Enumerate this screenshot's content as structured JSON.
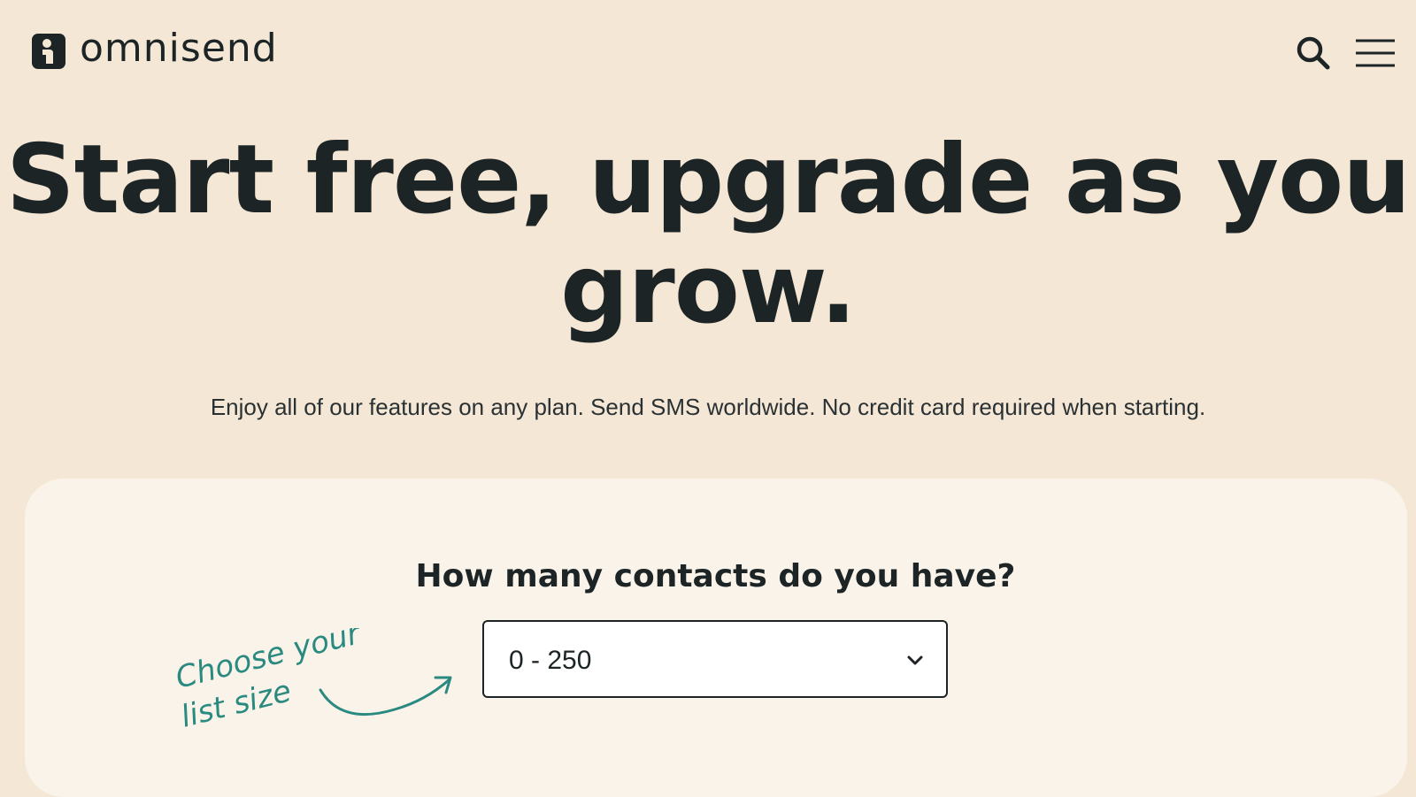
{
  "header": {
    "logo_text": "omnisend",
    "logo_icon": "omnisend-logo-icon",
    "search_icon": "search-icon",
    "menu_icon": "hamburger-menu-icon"
  },
  "hero": {
    "title": "Start free, upgrade as you grow.",
    "subtitle": "Enjoy all of our features on any plan. Send SMS worldwide. No credit card required when starting."
  },
  "pricing_card": {
    "question": "How many contacts do you have?",
    "contacts_select": {
      "value": "0 - 250",
      "icon": "chevron-down-icon"
    },
    "annotation": {
      "line1": "Choose your",
      "line2": "list size",
      "icon": "curved-arrow-icon"
    }
  },
  "colors": {
    "background": "#f4e7d6",
    "card": "#faf3ea",
    "text": "#1d2426",
    "annotation": "#2a8a80"
  }
}
